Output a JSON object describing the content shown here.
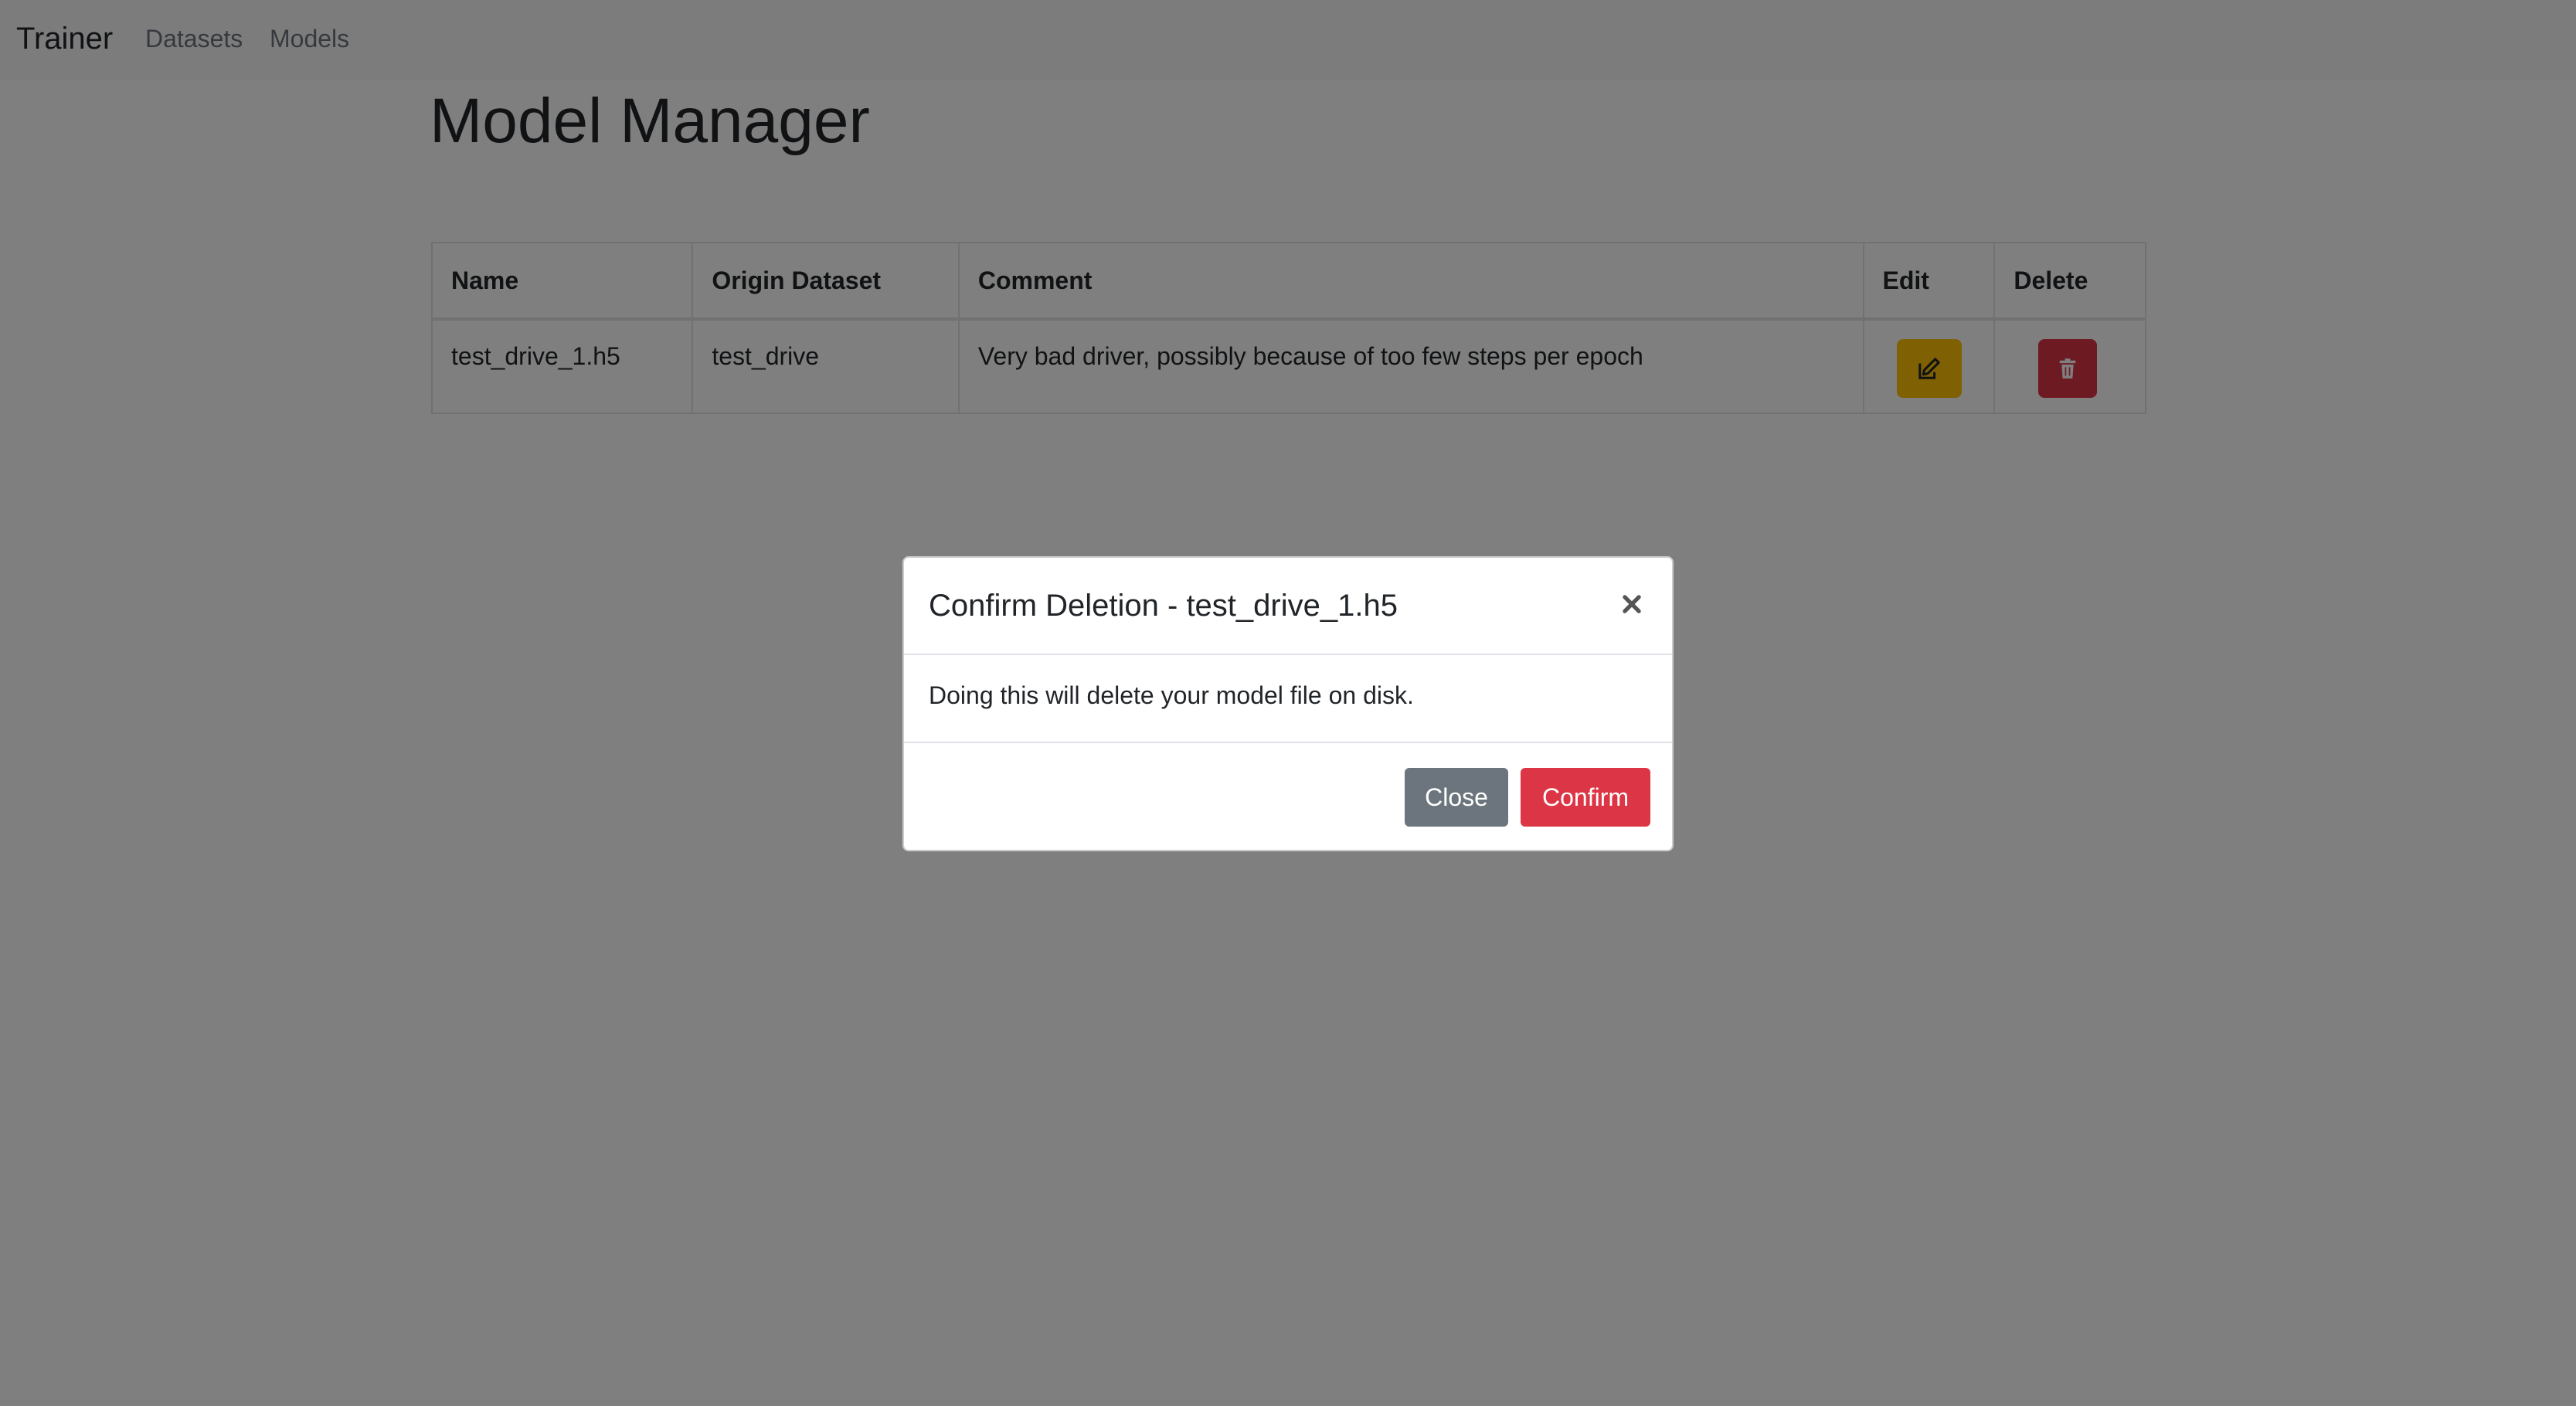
{
  "navbar": {
    "brand": "Trainer",
    "links": [
      "Datasets",
      "Models"
    ]
  },
  "page": {
    "title": "Model Manager"
  },
  "table": {
    "headers": [
      "Name",
      "Origin Dataset",
      "Comment",
      "Edit",
      "Delete"
    ],
    "rows": [
      {
        "name": "test_drive_1.h5",
        "origin_dataset": "test_drive",
        "comment": "Very bad driver, possibly because of too few steps per epoch",
        "edit_icon": "edit-icon",
        "delete_icon": "trash-icon"
      }
    ]
  },
  "modal": {
    "title": "Confirm Deletion - test_drive_1.h5",
    "body": "Doing this will delete your model file on disk.",
    "close_label": "Close",
    "confirm_label": "Confirm",
    "close_icon": "close-icon"
  },
  "colors": {
    "warning": "#ffc107",
    "danger": "#dc3545",
    "secondary": "#6c757d",
    "navbar_bg": "#f8f9fa"
  }
}
